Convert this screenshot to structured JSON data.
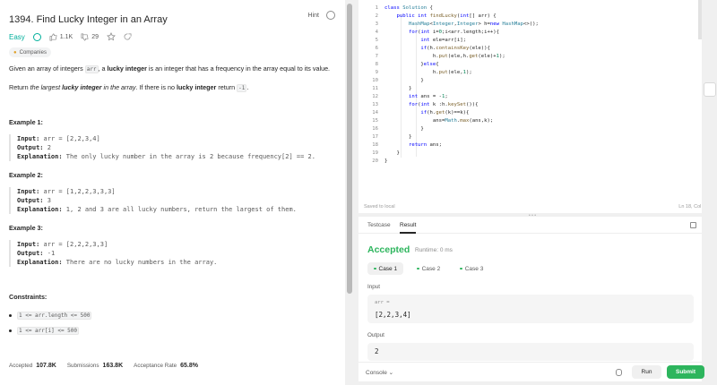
{
  "problem": {
    "title": "1394. Find Lucky Integer in an Array",
    "hint_label": "Hint",
    "difficulty": "Easy",
    "likes": "1.1K",
    "dislikes": "29",
    "tag_label": "Companies",
    "description": {
      "p1_a": "Given an array of integers ",
      "p1_code": "arr",
      "p1_b": ", a ",
      "p1_bold": "lucky integer",
      "p1_c": " is an integer that has a frequency in the array equal to its value.",
      "p2_a": "Return ",
      "p2_italic": "the largest ",
      "p2_bolditalic": "lucky integer",
      "p2_italic2": " in the array",
      "p2_b": ". If there is no ",
      "p2_bold": "lucky integer",
      "p2_c": " return ",
      "p2_code": "-1",
      "p2_d": "."
    },
    "examples": [
      {
        "title": "Example 1:",
        "input_label": "Input:",
        "input": "arr = [2,2,3,4]",
        "output_label": "Output:",
        "output": "2",
        "explanation_label": "Explanation:",
        "explanation": "The only lucky number in the array is 2 because frequency[2] == 2."
      },
      {
        "title": "Example 2:",
        "input_label": "Input:",
        "input": "arr = [1,2,2,3,3,3]",
        "output_label": "Output:",
        "output": "3",
        "explanation_label": "Explanation:",
        "explanation": "1, 2 and 3 are all lucky numbers, return the largest of them."
      },
      {
        "title": "Example 3:",
        "input_label": "Input:",
        "input": "arr = [2,2,2,3,3]",
        "output_label": "Output:",
        "output": "-1",
        "explanation_label": "Explanation:",
        "explanation": "There are no lucky numbers in the array."
      }
    ],
    "constraints_title": "Constraints:",
    "constraints": [
      "1 <= arr.length <= 500",
      "1 <= arr[i] <= 500"
    ],
    "stats": {
      "accepted_label": "Accepted",
      "accepted": "107.8K",
      "submissions_label": "Submissions",
      "submissions": "163.8K",
      "rate_label": "Acceptance Rate",
      "rate": "65.8%"
    }
  },
  "editor": {
    "line_numbers": [
      "1",
      "2",
      "3",
      "4",
      "5",
      "6",
      "7",
      "8",
      "9",
      "10",
      "11",
      "12",
      "13",
      "14",
      "15",
      "16",
      "17",
      "18",
      "19",
      "20"
    ],
    "status_left": "Saved to local",
    "status_right": "Ln 18, Col 20"
  },
  "result": {
    "tabs": [
      "Testcase",
      "Result"
    ],
    "status": "Accepted",
    "runtime": "Runtime: 0 ms",
    "cases": [
      "Case 1",
      "Case 2",
      "Case 3"
    ],
    "input_label": "Input",
    "input_var": "arr =",
    "input_value": "[2,2,3,4]",
    "output_label": "Output",
    "output_value": "2",
    "console_label": "Console",
    "run_label": "Run",
    "submit_label": "Submit"
  },
  "icons": {
    "hint": "hint-icon",
    "solved": "check-circle-icon",
    "like": "thumbs-up-icon",
    "dislike": "thumbs-down-icon",
    "star": "star-icon",
    "share": "share-icon",
    "lock": "lock-icon",
    "layout": "layout-icon",
    "debug": "bug-icon",
    "chevron": "chevron-down-icon"
  },
  "colors": {
    "easy": "#00af9b",
    "accepted": "#2db55d",
    "submit": "#2db55d",
    "keyword": "#0000ff",
    "type": "#267f99"
  }
}
